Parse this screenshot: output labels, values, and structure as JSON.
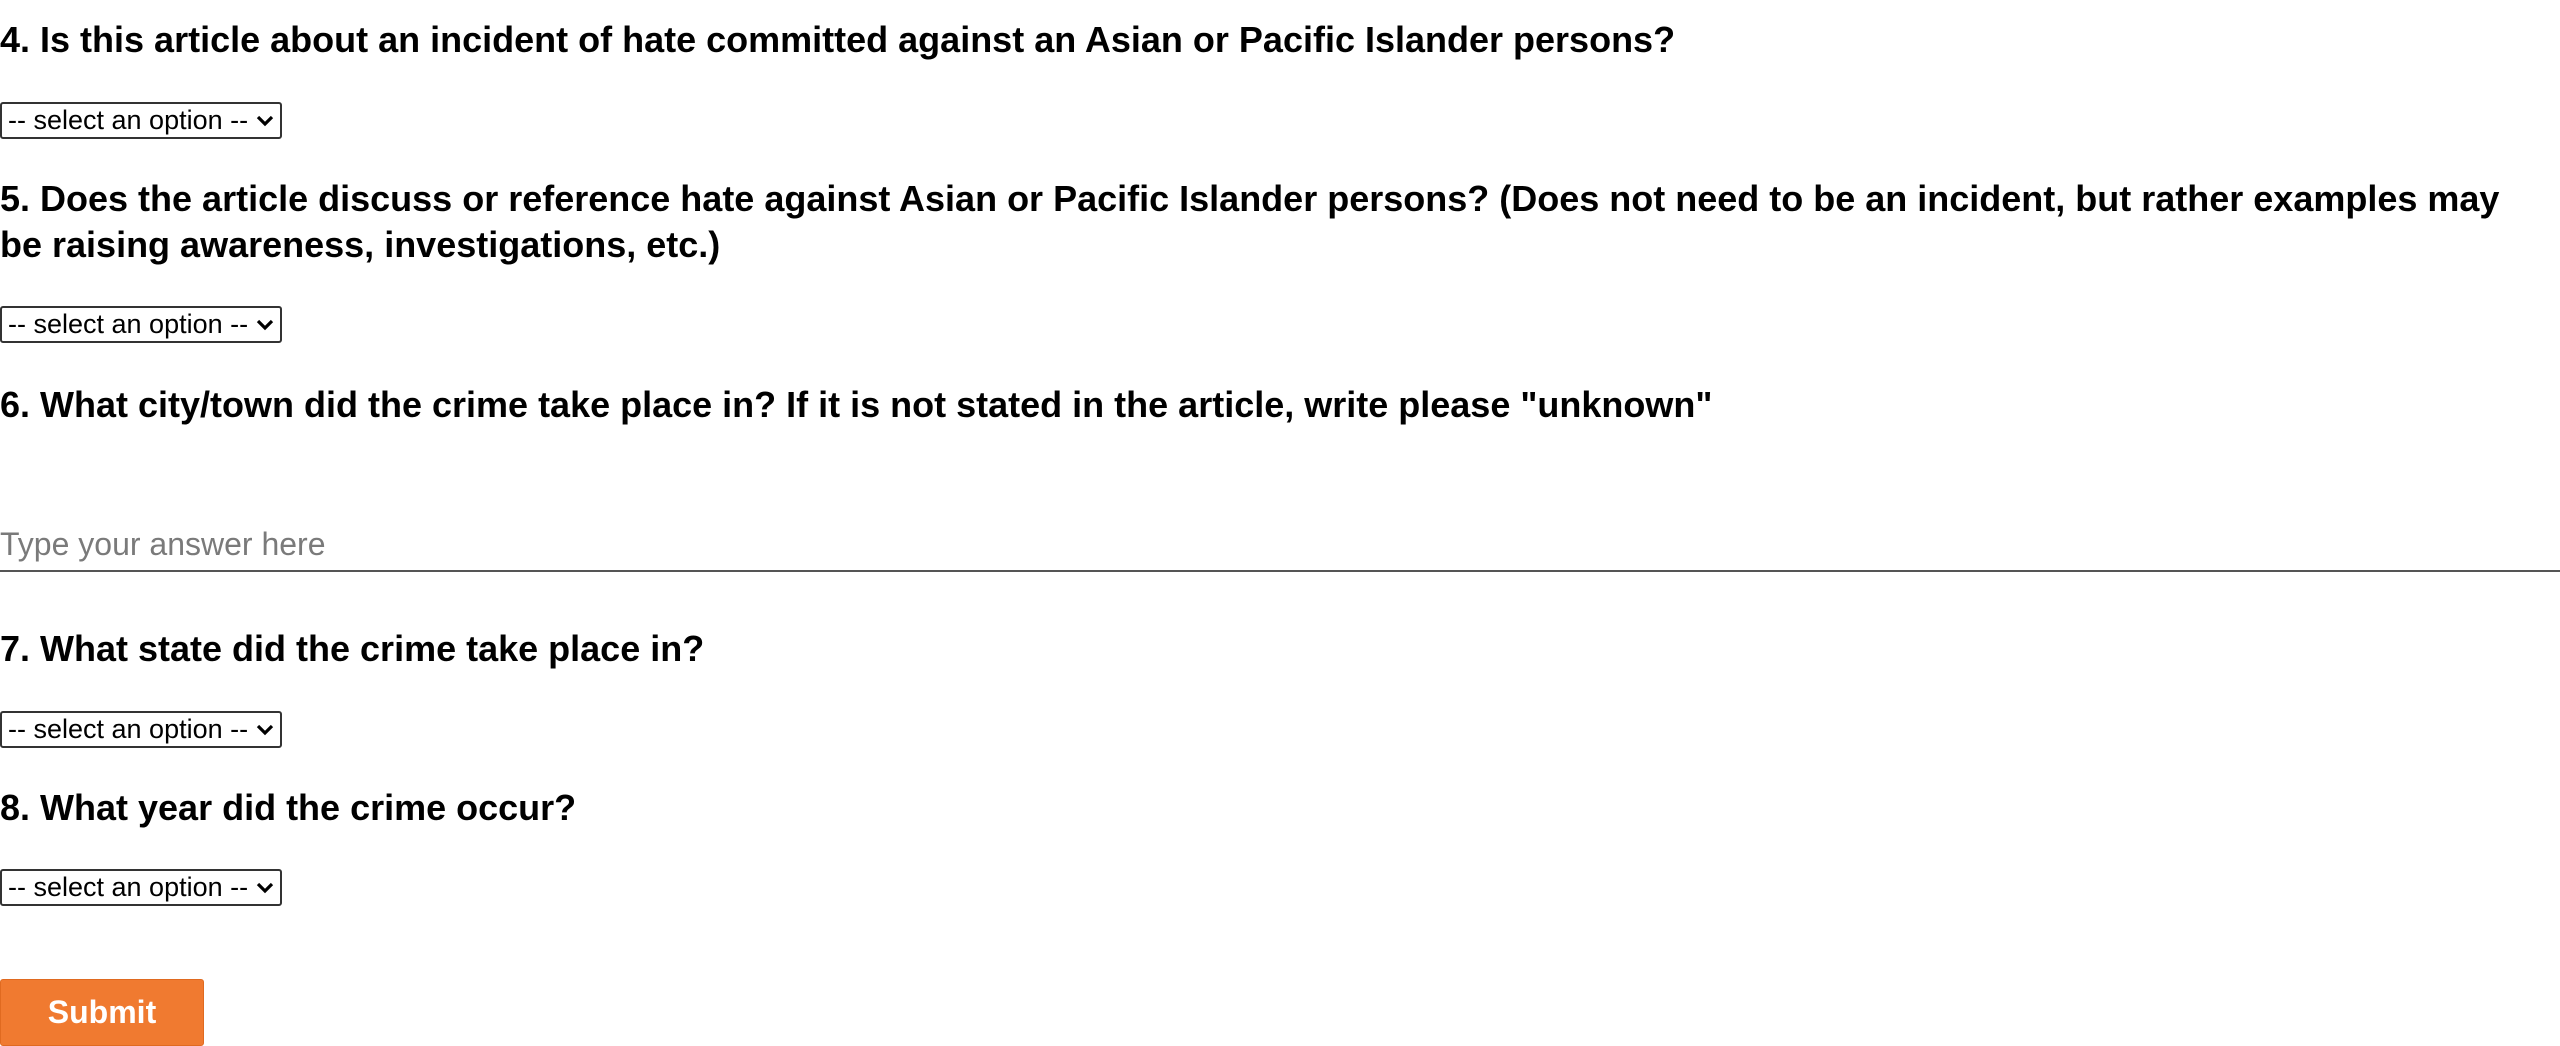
{
  "questions": {
    "q4": {
      "title": "4. Is this article about an incident of hate committed against an Asian or Pacific Islander persons?",
      "select_value": "-- select an option --"
    },
    "q5": {
      "title": "5. Does the article discuss or reference hate against Asian or Pacific Islander persons? (Does not need to be an incident, but rather examples may be raising awareness, investigations, etc.)",
      "select_value": "-- select an option --"
    },
    "q6": {
      "title": "6. What city/town did the crime take place in? If it is not stated in the article, write please \"unknown\"",
      "input_placeholder": "Type your answer here",
      "input_value": ""
    },
    "q7": {
      "title": "7. What state did the crime take place in?",
      "select_value": "-- select an option --"
    },
    "q8": {
      "title": "8. What year did the crime occur?",
      "select_value": "-- select an option --"
    }
  },
  "submit": {
    "label": "Submit"
  },
  "icons": {
    "dropdown": "chevron-down-icon"
  },
  "colors": {
    "submit_bg": "#f07a30",
    "placeholder": "#7a7a7a"
  }
}
